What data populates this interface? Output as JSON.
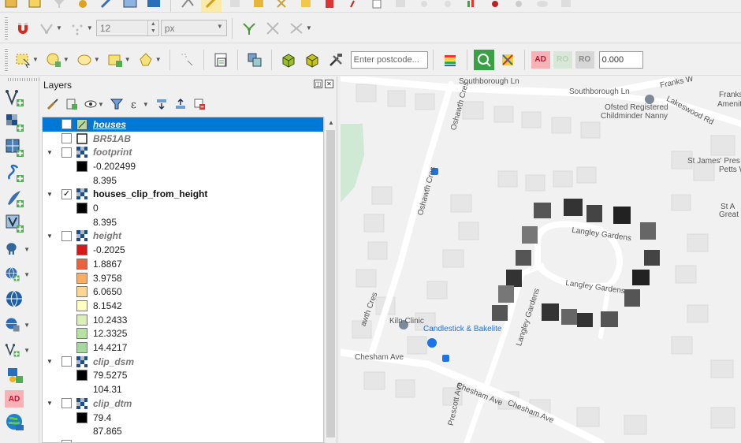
{
  "toolbar2": {
    "size_value": "12",
    "unit_value": "px"
  },
  "toolbar3": {
    "postcode_placeholder": "Enter postcode...",
    "ad_label": "AD",
    "ro_label": "RO",
    "ro2_label": "RO",
    "coord_value": "0.000"
  },
  "left_toolbar": {
    "ad_label": "AD"
  },
  "layers_panel": {
    "title": "Layers",
    "layers": [
      {
        "name": "houses",
        "checked": false,
        "type": "vector",
        "selected": true
      },
      {
        "name": "BR51AB",
        "checked": false,
        "type": "polygon"
      },
      {
        "name": "footprint",
        "checked": false,
        "type": "raster",
        "expanded": true,
        "legend": [
          "-0.202499",
          "8.395"
        ]
      },
      {
        "name": "houses_clip_from_height",
        "checked": true,
        "type": "raster",
        "expanded": true,
        "legend": [
          "0",
          "8.395"
        ]
      },
      {
        "name": "height",
        "checked": false,
        "type": "raster",
        "expanded": true,
        "legend": [
          "-0.2025",
          "1.8867",
          "3.9758",
          "6.0650",
          "8.1542",
          "10.2433",
          "12.3325",
          "14.4217"
        ],
        "legend_colors": [
          "#d7191c",
          "#ea633e",
          "#fdae61",
          "#fed690",
          "#ffffbf",
          "#dbf0b8",
          "#b8e1a4",
          "#a6d8a0"
        ]
      },
      {
        "name": "clip_dsm",
        "checked": false,
        "type": "raster",
        "expanded": true,
        "legend": [
          "79.5275",
          "104.31"
        ]
      },
      {
        "name": "clip_dtm",
        "checked": false,
        "type": "raster",
        "expanded": true,
        "legend": [
          "79.4",
          "87.865"
        ]
      }
    ]
  },
  "map": {
    "labels": {
      "southborough_top": "Southborough Ln",
      "southborough": "Southborough Ln",
      "franks": "Franks W",
      "ofsted": "Ofsted Registered",
      "childminder": "Childminder Nanny",
      "lakeswood": "Lakeswood Rd",
      "oshawth_top": "Oshawth Cres",
      "oshawth": "Oshawth Cres",
      "st_james": "St James' Pres",
      "petts": "Petts W",
      "st_right": "St A",
      "great": "Great R",
      "langley_n": "Langley Gardens",
      "langley_s": "Langley Gardens",
      "langley_w": "Langley Gardens",
      "awth": "awth Cres",
      "kiln": "Kiln Clinic",
      "candlestick": "Candlestick & Bakelite",
      "chesham": "Chesham Ave",
      "chesham2": "Chesham Ave",
      "chesham3": "Chesham Ave",
      "prescott": "Prescott Ave",
      "franks_right": "Franks",
      "amenit": "Amenit"
    },
    "colors": {
      "road": "#ffffff",
      "building": "#e8e8e8",
      "park": "#cfe9d4",
      "accent_blue": "#1a73e8",
      "poi_gray": "#7a8a99"
    }
  }
}
